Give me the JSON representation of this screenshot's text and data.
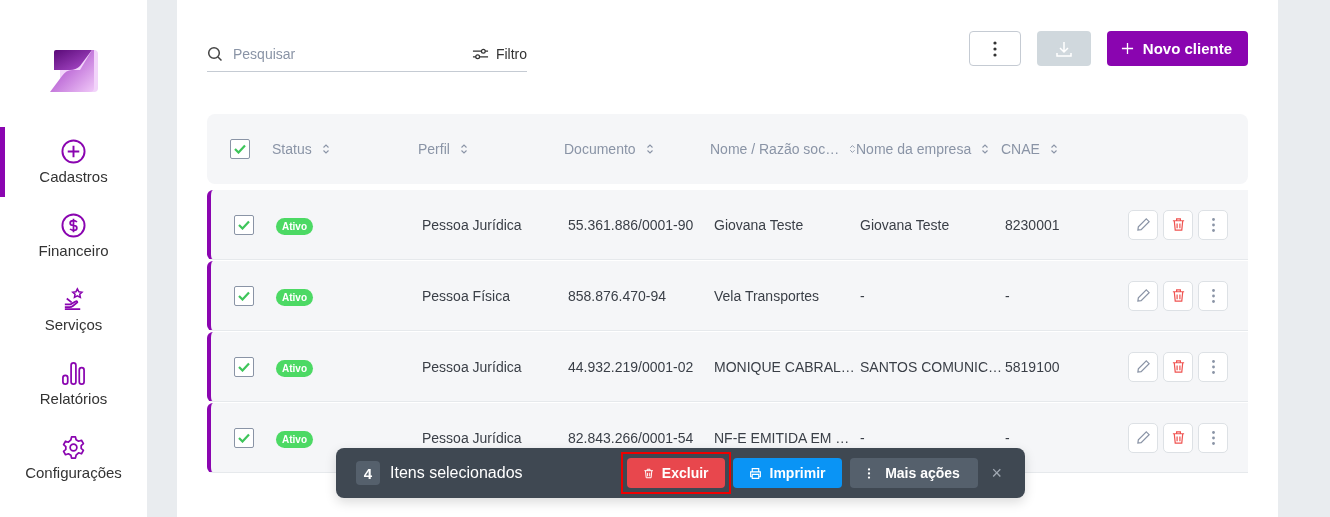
{
  "sidebar": {
    "items": [
      {
        "label": "Cadastros",
        "selected": true
      },
      {
        "label": "Financeiro",
        "selected": false
      },
      {
        "label": "Serviços",
        "selected": false
      },
      {
        "label": "Relatórios",
        "selected": false
      },
      {
        "label": "Configurações",
        "selected": false
      }
    ]
  },
  "search": {
    "placeholder": "Pesquisar",
    "filter_label": "Filtro"
  },
  "toolbar": {
    "download_disabled": true,
    "new_button": "Novo cliente"
  },
  "table": {
    "all_checked": true,
    "columns": [
      "Status",
      "Perfil",
      "Documento",
      "Nome / Razão soc…",
      "Nome da empresa",
      "CNAE"
    ],
    "rows": [
      {
        "checked": true,
        "cells": [
          "Ativo",
          "Pessoa Jurídica",
          "55.361.886/0001-90",
          "Giovana Teste",
          "Giovana Teste",
          "8230001"
        ]
      },
      {
        "checked": true,
        "cells": [
          "Ativo",
          "Pessoa Física",
          "858.876.470-94",
          "Vela Transportes",
          "-",
          "-"
        ]
      },
      {
        "checked": true,
        "cells": [
          "Ativo",
          "Pessoa Jurídica",
          "44.932.219/0001-02",
          "MONIQUE CABRAL…",
          "SANTOS COMUNIC…",
          "5819100"
        ]
      },
      {
        "checked": true,
        "cells": [
          "Ativo",
          "Pessoa Jurídica",
          "82.843.266/0001-54",
          "NF-E EMITIDA EM …",
          "-",
          "-"
        ]
      }
    ]
  },
  "bulk_bar": {
    "count": "4",
    "label": "Itens selecionados",
    "close": "×",
    "actions": [
      {
        "label": "Excluir",
        "kind": "danger",
        "highlighted": true
      },
      {
        "label": "Imprimir",
        "kind": "primary",
        "highlighted": false
      },
      {
        "label": "Mais ações",
        "kind": "secondary",
        "highlighted": false
      }
    ]
  }
}
